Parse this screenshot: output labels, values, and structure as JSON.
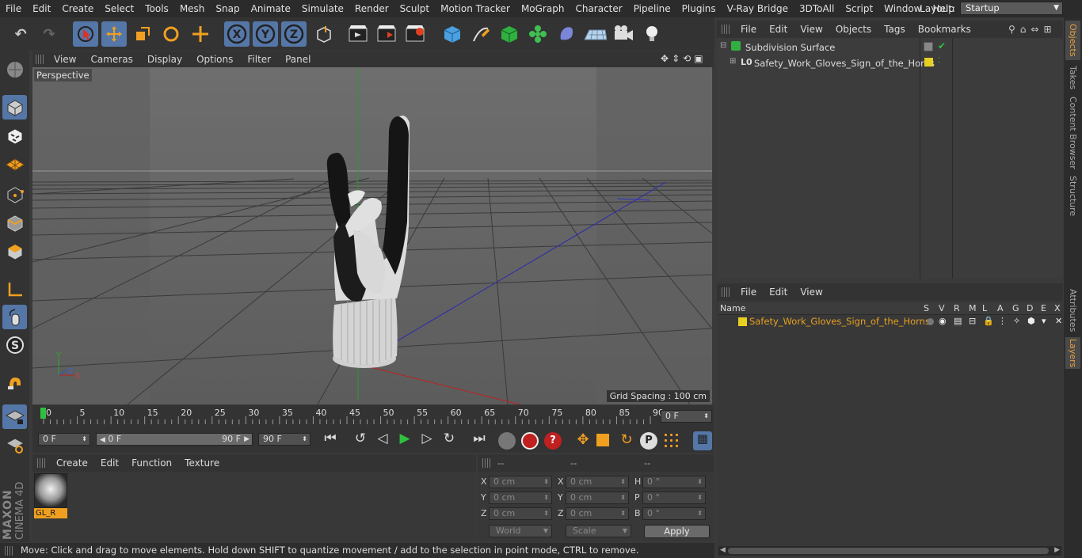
{
  "menu": [
    "File",
    "Edit",
    "Create",
    "Select",
    "Tools",
    "Mesh",
    "Snap",
    "Animate",
    "Simulate",
    "Render",
    "Sculpt",
    "Motion Tracker",
    "MoGraph",
    "Character",
    "Pipeline",
    "Plugins",
    "V-Ray Bridge",
    "3DToAll",
    "Script",
    "Window",
    "Help"
  ],
  "layout": {
    "label": "Layout:",
    "value": "Startup"
  },
  "viewport": {
    "menu": [
      "View",
      "Cameras",
      "Display",
      "Options",
      "Filter",
      "Panel"
    ],
    "camera_label": "Perspective",
    "grid_spacing": "Grid Spacing : 100 cm"
  },
  "timeline": {
    "ticks": [
      "0",
      "5",
      "10",
      "15",
      "20",
      "25",
      "30",
      "35",
      "40",
      "45",
      "50",
      "55",
      "60",
      "65",
      "70",
      "75",
      "80",
      "85",
      "90"
    ],
    "current_frame": "0 F"
  },
  "transport": {
    "start_field": "0 F",
    "range_start": "0 F",
    "range_end": "90 F",
    "end_field": "90 F"
  },
  "materials": {
    "menu": [
      "Create",
      "Edit",
      "Function",
      "Texture"
    ],
    "items": [
      {
        "name": "GL_R"
      }
    ]
  },
  "coords": {
    "headers": [
      "--",
      "--",
      "--"
    ],
    "rows": [
      {
        "a": "X",
        "av": "0 cm",
        "b": "X",
        "bv": "0 cm",
        "c": "H",
        "cv": "0 °"
      },
      {
        "a": "Y",
        "av": "0 cm",
        "b": "Y",
        "bv": "0 cm",
        "c": "P",
        "cv": "0 °"
      },
      {
        "a": "Z",
        "av": "0 cm",
        "b": "Z",
        "bv": "0 cm",
        "c": "B",
        "cv": "0 °"
      }
    ],
    "mode1": "World",
    "mode2": "Scale",
    "apply": "Apply"
  },
  "objects_panel": {
    "menu": [
      "File",
      "Edit",
      "View",
      "Objects",
      "Tags",
      "Bookmarks"
    ],
    "items": [
      {
        "name": "Subdivision Surface"
      },
      {
        "name": "Safety_Work_Gloves_Sign_of_the_Horns"
      }
    ]
  },
  "layers_panel": {
    "menu": [
      "File",
      "Edit",
      "View"
    ],
    "columns": [
      "Name",
      "S",
      "V",
      "R",
      "M",
      "L",
      "A",
      "G",
      "D",
      "E",
      "X"
    ],
    "rows": [
      {
        "name": "Safety_Work_Gloves_Sign_of_the_Horns"
      }
    ]
  },
  "right_tabs": [
    "Objects",
    "Takes",
    "Content Browser",
    "Structure",
    "Attributes",
    "Layers"
  ],
  "status": "Move: Click and drag to move elements. Hold down SHIFT to quantize movement / add to the selection in point mode, CTRL to remove.",
  "brand": {
    "line1": "MAXON",
    "line2": "CINEMA 4D"
  },
  "colors": {
    "accent": "#5577a8",
    "layer_yellow": "#e8d020",
    "layer_text": "#e8a020"
  }
}
